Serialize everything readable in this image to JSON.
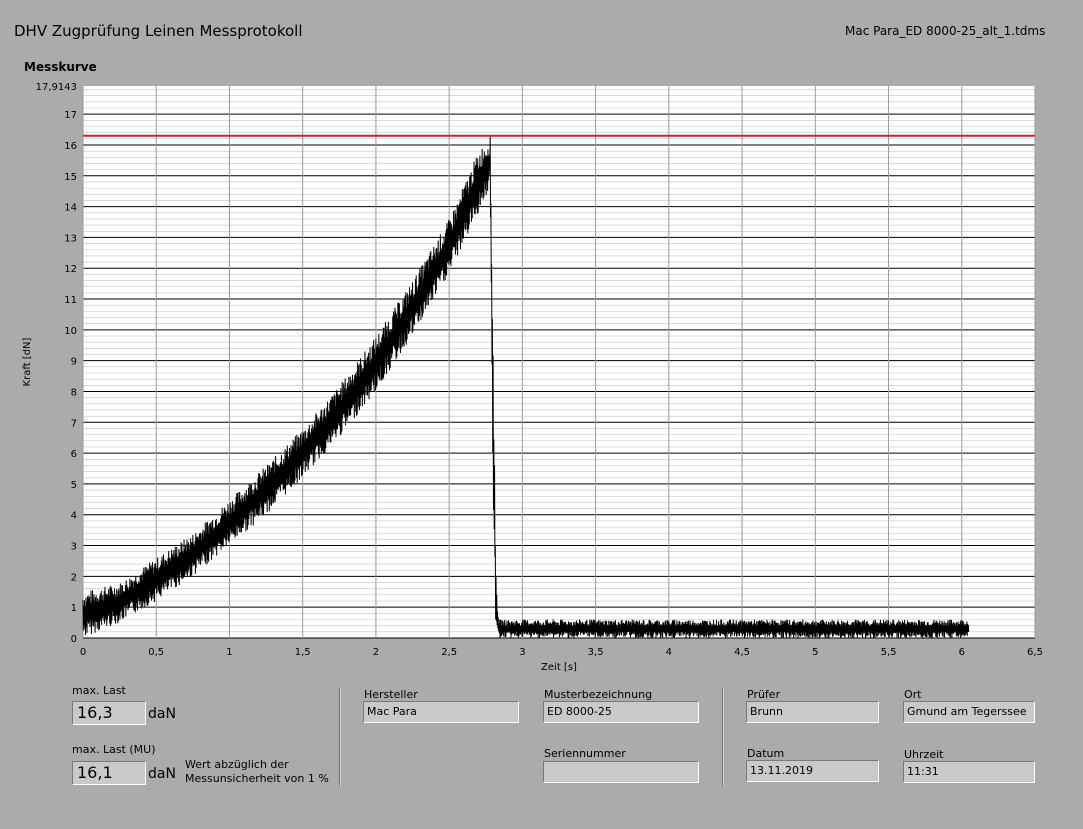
{
  "header": {
    "title": "DHV Zugprüfung Leinen Messprotokoll",
    "file": "Mac Para_ED 8000-25_alt_1.tdms"
  },
  "chart_data": {
    "type": "line",
    "title": "Messkurve",
    "xlabel": "Zeit [s]",
    "ylabel": "Kraft [dN]",
    "xlim": [
      0,
      6.5
    ],
    "ylim": [
      0,
      17.9143
    ],
    "ymax_label": "17,9143",
    "xticks": [
      "0",
      "0,5",
      "1",
      "1,5",
      "2",
      "2,5",
      "3",
      "3,5",
      "4",
      "4,5",
      "5",
      "5,5",
      "6",
      "6,5"
    ],
    "yticks": [
      "0",
      "1",
      "2",
      "3",
      "4",
      "5",
      "6",
      "7",
      "8",
      "9",
      "10",
      "11",
      "12",
      "13",
      "14",
      "15",
      "16",
      "17"
    ],
    "grid": true,
    "max_line": {
      "value": 16.3,
      "color": "#d42020"
    },
    "series": [
      {
        "color": "#000000",
        "envelope": [
          {
            "x": 0.0,
            "lo": 0.0,
            "hi": 1.5
          },
          {
            "x": 0.25,
            "lo": 0.5,
            "hi": 1.8
          },
          {
            "x": 0.5,
            "lo": 1.2,
            "hi": 2.6
          },
          {
            "x": 0.75,
            "lo": 2.0,
            "hi": 3.4
          },
          {
            "x": 1.0,
            "lo": 3.0,
            "hi": 4.5
          },
          {
            "x": 1.25,
            "lo": 4.0,
            "hi": 5.6
          },
          {
            "x": 1.5,
            "lo": 5.2,
            "hi": 6.8
          },
          {
            "x": 1.75,
            "lo": 6.5,
            "hi": 8.2
          },
          {
            "x": 2.0,
            "lo": 8.0,
            "hi": 9.8
          },
          {
            "x": 2.25,
            "lo": 9.8,
            "hi": 11.6
          },
          {
            "x": 2.5,
            "lo": 11.8,
            "hi": 13.6
          },
          {
            "x": 2.7,
            "lo": 13.8,
            "hi": 15.8
          },
          {
            "x": 2.78,
            "lo": 14.6,
            "hi": 16.3
          },
          {
            "x": 2.8,
            "lo": 4.0,
            "hi": 10.0
          },
          {
            "x": 2.82,
            "lo": 0.0,
            "hi": 2.0
          },
          {
            "x": 2.84,
            "lo": 0.0,
            "hi": 0.6
          },
          {
            "x": 6.05,
            "lo": 0.0,
            "hi": 0.6
          }
        ]
      }
    ]
  },
  "fields": {
    "max_last": {
      "label": "max. Last",
      "value": "16,3",
      "unit": "daN"
    },
    "max_last_mu": {
      "label": "max. Last (MU)",
      "value": "16,1",
      "unit": "daN",
      "note1": "Wert abzüglich der",
      "note2": "Messunsicherheit von 1 %"
    },
    "hersteller": {
      "label": "Hersteller",
      "value": "Mac Para"
    },
    "musterbezeichnung": {
      "label": "Musterbezeichnung",
      "value": "ED 8000-25"
    },
    "seriennummer": {
      "label": "Seriennummer",
      "value": ""
    },
    "pruefer": {
      "label": "Prüfer",
      "value": "Brunn"
    },
    "ort": {
      "label": "Ort",
      "value": "Gmund am Tegerssee"
    },
    "datum": {
      "label": "Datum",
      "value": "13.11.2019"
    },
    "uhrzeit": {
      "label": "Uhrzeit",
      "value": "11:31"
    }
  }
}
